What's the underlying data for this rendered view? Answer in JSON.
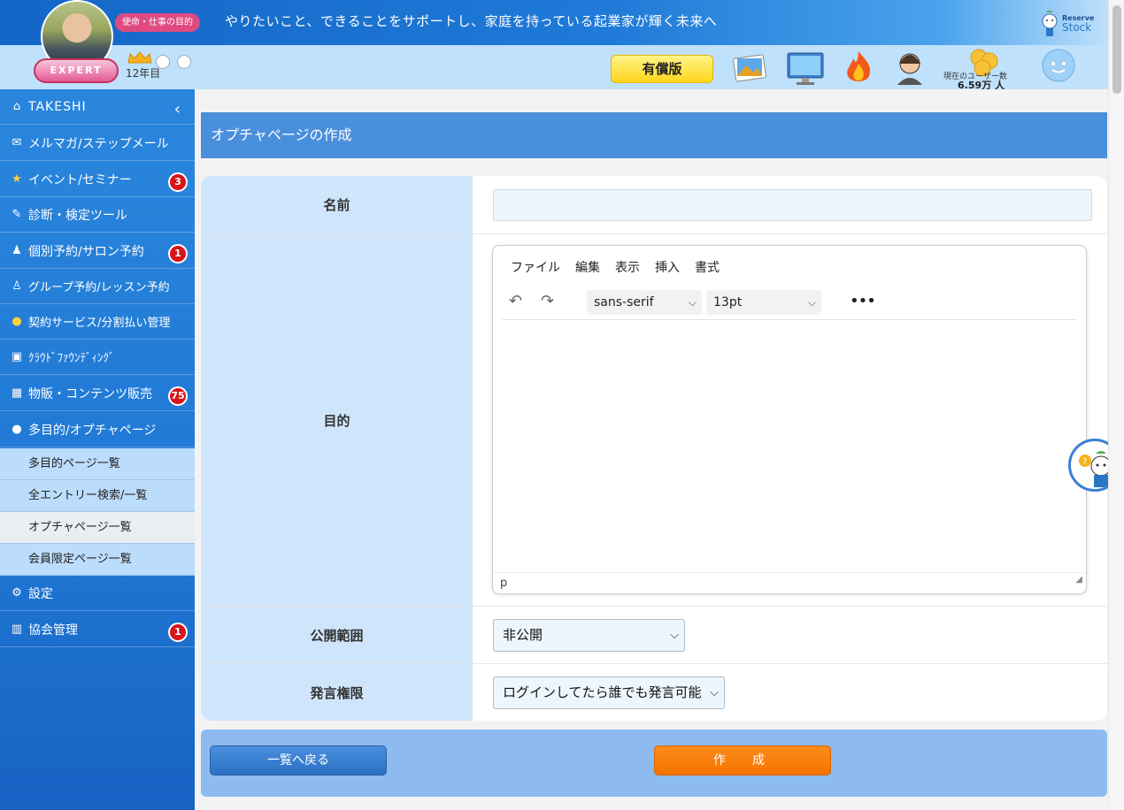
{
  "banner": {
    "mission_badge": "使命・仕事の目的",
    "mission_text": "やりたいこと、できることをサポートし、家庭を持っている起業家が輝く未来へ",
    "logo_line1": "Reserve",
    "logo_line2": "Stock"
  },
  "profile": {
    "rank": "EXPERT",
    "years": "12年目"
  },
  "topbar": {
    "paid_label": "有償版",
    "user_count_label": "現在のユーザー数",
    "user_count_value": "6.59万 人",
    "icons": [
      "gallery-icon",
      "monitor-icon",
      "fire-icon",
      "support-operator-icon",
      "user-count-icon",
      "chat-icon"
    ]
  },
  "sidebar": {
    "user": "TAKESHI",
    "items": [
      {
        "label": "メルマガ/ステップメール",
        "icon": "mail-icon",
        "badge": ""
      },
      {
        "label": "イベント/セミナー",
        "icon": "star-icon",
        "badge": "3"
      },
      {
        "label": "診断・検定ツール",
        "icon": "tools-icon",
        "badge": ""
      },
      {
        "label": "個別予約/サロン予約",
        "icon": "person-icon",
        "badge": "1"
      },
      {
        "label": "グループ予約/レッスン予約",
        "icon": "group-icon",
        "badge": ""
      },
      {
        "label": "契約サービス/分割払い管理",
        "icon": "contract-icon",
        "badge": ""
      },
      {
        "label": "ｸﾗｳﾄﾞﾌｧｳﾝﾃﾞｨﾝｸﾞ",
        "icon": "crowdfunding-icon",
        "badge": ""
      },
      {
        "label": "物販・コンテンツ販売",
        "icon": "cart-icon",
        "badge": "75"
      },
      {
        "label": "多目的/オプチャページ",
        "icon": "bubble-icon",
        "badge": ""
      }
    ],
    "sub_items": [
      {
        "label": "多目的ページ一覧"
      },
      {
        "label": "全エントリー検索/一覧"
      },
      {
        "label": "オプチャページ一覧"
      },
      {
        "label": "会員限定ページ一覧"
      }
    ],
    "bottom_items": [
      {
        "label": "設定",
        "icon": "gear-icon",
        "badge": ""
      },
      {
        "label": "協会管理",
        "icon": "building-icon",
        "badge": "1"
      }
    ]
  },
  "page": {
    "title": "オプチャページの作成"
  },
  "form": {
    "name_label": "名前",
    "name_value": "",
    "purpose_label": "目的",
    "editor": {
      "menu": [
        "ファイル",
        "編集",
        "表示",
        "挿入",
        "書式"
      ],
      "font_family": "sans-serif",
      "font_size": "13pt",
      "more": "•••",
      "status_path": "p"
    },
    "visibility_label": "公開範囲",
    "visibility_value": "非公開",
    "permission_label": "発言権限",
    "permission_value": "ログインしてたら誰でも発言可能"
  },
  "actions": {
    "back_label": "一覧へ戻る",
    "create_label": "作　成"
  }
}
